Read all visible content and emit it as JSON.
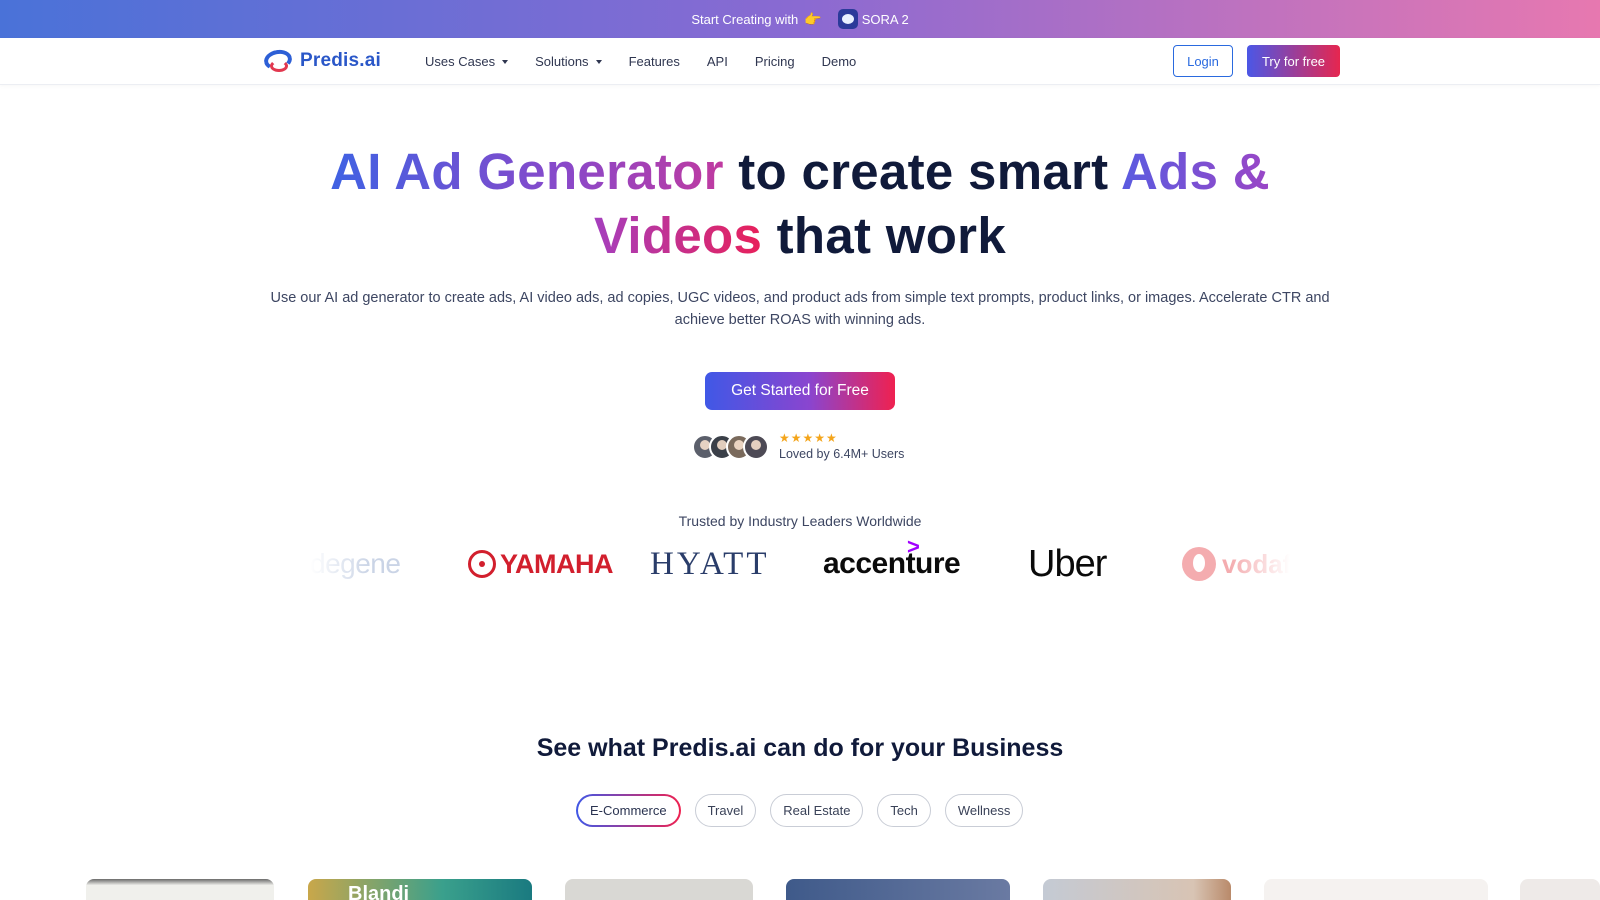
{
  "banner": {
    "text": "Start Creating with",
    "hand_icon": "👉",
    "product_icon": "sora-logo-icon",
    "product": "SORA 2"
  },
  "nav": {
    "brand": "Predis.ai",
    "items": [
      {
        "label": "Uses Cases",
        "dropdown": true
      },
      {
        "label": "Solutions",
        "dropdown": true
      },
      {
        "label": "Features",
        "dropdown": false
      },
      {
        "label": "API",
        "dropdown": false
      },
      {
        "label": "Pricing",
        "dropdown": false
      },
      {
        "label": "Demo",
        "dropdown": false
      }
    ],
    "login": "Login",
    "try": "Try for free"
  },
  "hero": {
    "title_parts": {
      "p1": "AI Ad Generator",
      "p2": " to create smart ",
      "p3": "Ads &",
      "p4": "Videos",
      "p5": " that work"
    },
    "subtitle": "Use our AI ad generator to create ads, AI video ads, ad copies, UGC videos, and product ads from simple text prompts, product links, or images. Accelerate CTR and achieve better ROAS with winning ads.",
    "cta": "Get Started for Free",
    "stars": "★★★★★",
    "rating_count": 5,
    "loved": "Loved by 6.4M+ Users"
  },
  "trusted": {
    "heading": "Trusted by Industry Leaders Worldwide",
    "logos": [
      "degene",
      "YAMAHA",
      "HYATT",
      "accenture",
      "Uber",
      "vodafone"
    ],
    "logo_visible_text": {
      "degene": "degene",
      "yamaha": "YAMAHA",
      "hyatt": "HYATT",
      "accenture": "accenture",
      "uber": "Uber",
      "vodafone": "vodaf"
    }
  },
  "business": {
    "title": "See what Predis.ai can do for your Business",
    "tabs": [
      {
        "label": "E-Commerce",
        "active": true
      },
      {
        "label": "Travel",
        "active": false
      },
      {
        "label": "Real Estate",
        "active": false
      },
      {
        "label": "Tech",
        "active": false
      },
      {
        "label": "Wellness",
        "active": false
      }
    ],
    "card_peek_text": "Blandi"
  },
  "colors": {
    "brand_blue": "#2a57c8",
    "gradient_start": "#4058e6",
    "gradient_end": "#ef2150",
    "star": "#f4a51b",
    "heading": "#101a3a"
  }
}
